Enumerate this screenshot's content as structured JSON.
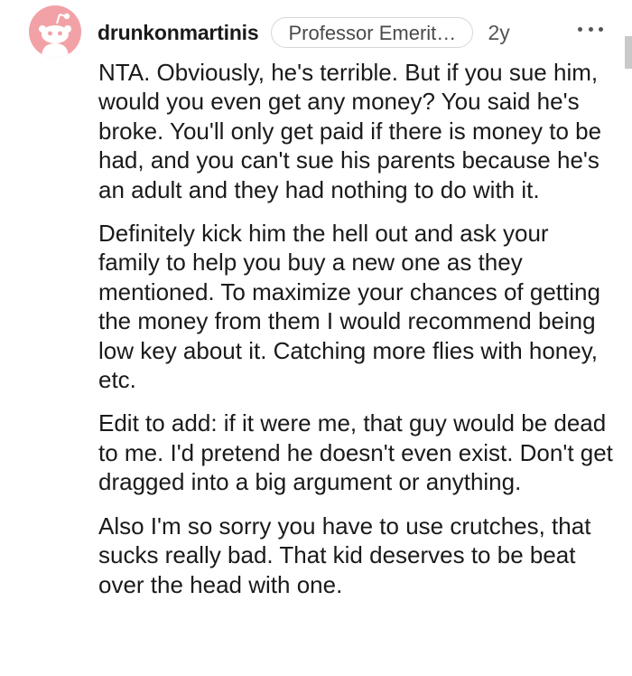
{
  "comment": {
    "username": "drunkonmartinis",
    "flair": "Professor Emeritass [...",
    "age": "2y",
    "avatar_icon": "reddit-snoo-icon",
    "avatar_color": "#f2a2a6",
    "paragraphs": [
      "NTA. Obviously, he's terrible. But if you sue him, would you even get any money? You said he's broke. You'll only get paid if there is money to be had, and you can't sue his parents because he's an adult and they had nothing to do with it.",
      "Definitely kick him the hell out and ask your family to help you buy a new one as they mentioned. To maximize your chances of getting the money from them I would recommend being low key about it. Catching more flies with honey, etc.",
      "Edit to add: if it were me, that guy would be dead to me. I'd pretend he doesn't even exist. Don't get dragged into a big argument or anything.",
      "Also I'm so sorry you have to use crutches, that sucks really bad. That kid deserves to be beat over the head with one."
    ]
  },
  "icons": {
    "more": "more-options-icon"
  }
}
